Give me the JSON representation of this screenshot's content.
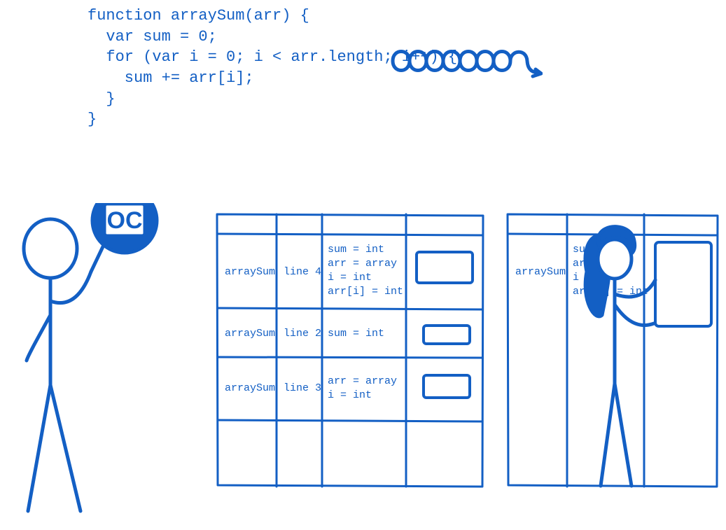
{
  "code": {
    "lines": [
      "function arraySum(arr) {",
      "  var sum = 0;",
      "  for (var i = 0; i < arr.length; i++) {",
      "    sum += arr[i];",
      "  }",
      "}"
    ]
  },
  "sign": {
    "label": "OC"
  },
  "table_left": {
    "rows": [
      {
        "fn": "arraySum",
        "line": "line 4",
        "types": [
          "sum = int",
          "arr = array",
          "i = int",
          "arr[i] = int"
        ]
      },
      {
        "fn": "arraySum",
        "line": "line 2",
        "types": [
          "sum = int"
        ]
      },
      {
        "fn": "arraySum",
        "line": "line 3",
        "types": [
          "arr = array",
          "i = int"
        ]
      }
    ]
  },
  "table_right": {
    "rows": [
      {
        "fn": "arraySum",
        "types": [
          "sum",
          "arr =",
          "i =",
          "arr[i] = int"
        ]
      }
    ]
  },
  "colors": {
    "ink": "#135fc4"
  }
}
